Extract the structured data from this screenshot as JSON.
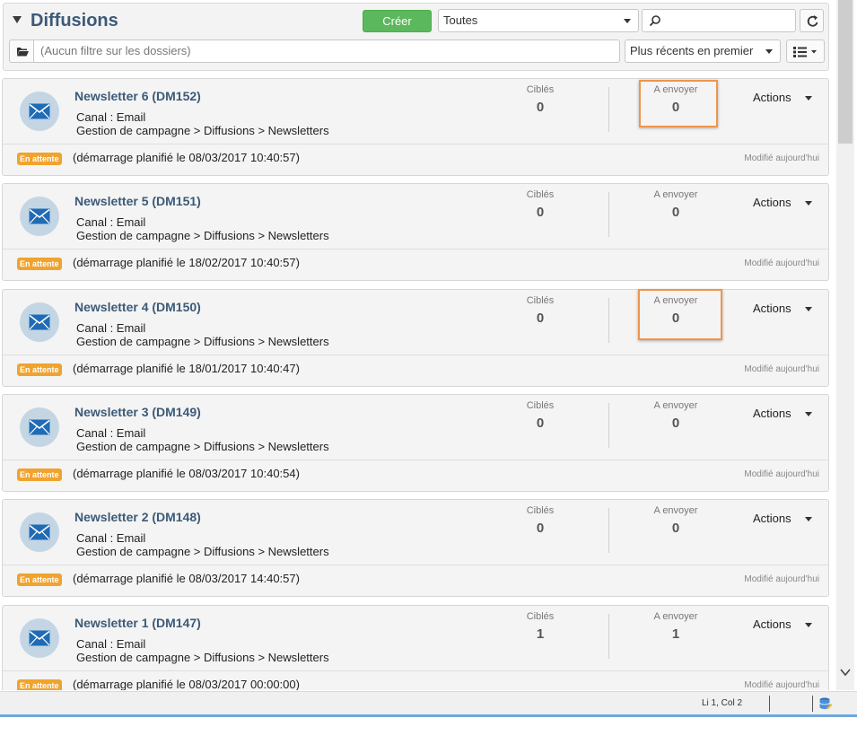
{
  "header": {
    "title": "Diffusions",
    "create_label": "Créer",
    "status_filter": "Toutes",
    "search_value": "",
    "folder_filter_placeholder": "(Aucun filtre sur les dossiers)",
    "sort_value": "Plus récents en premier"
  },
  "deliveries": [
    {
      "title": "Newsletter 6 (DM152)",
      "channel": "Canal : Email",
      "path": "Gestion de campagne > Diffusions > Newsletters",
      "targeted_label": "Ciblés",
      "targeted": "0",
      "tosend_label": "A envoyer",
      "tosend": "0",
      "actions": "Actions",
      "badge": "En attente",
      "schedule": "(démarrage planifié le 08/03/2017 10:40:57)",
      "modified": "Modifié aujourd'hui"
    },
    {
      "title": "Newsletter 5 (DM151)",
      "channel": "Canal : Email",
      "path": "Gestion de campagne > Diffusions > Newsletters",
      "targeted_label": "Ciblés",
      "targeted": "0",
      "tosend_label": "A envoyer",
      "tosend": "0",
      "actions": "Actions",
      "badge": "En attente",
      "schedule": "(démarrage planifié le 18/02/2017 10:40:57)",
      "modified": "Modifié aujourd'hui"
    },
    {
      "title": "Newsletter 4 (DM150)",
      "channel": "Canal : Email",
      "path": "Gestion de campagne > Diffusions > Newsletters",
      "targeted_label": "Ciblés",
      "targeted": "0",
      "tosend_label": "A envoyer",
      "tosend": "0",
      "actions": "Actions",
      "badge": "En attente",
      "schedule": "(démarrage planifié le 18/01/2017 10:40:47)",
      "modified": "Modifié aujourd'hui"
    },
    {
      "title": "Newsletter 3 (DM149)",
      "channel": "Canal : Email",
      "path": "Gestion de campagne > Diffusions > Newsletters",
      "targeted_label": "Ciblés",
      "targeted": "0",
      "tosend_label": "A envoyer",
      "tosend": "0",
      "actions": "Actions",
      "badge": "En attente",
      "schedule": "(démarrage planifié le 08/03/2017 10:40:54)",
      "modified": "Modifié aujourd'hui"
    },
    {
      "title": "Newsletter 2 (DM148)",
      "channel": "Canal : Email",
      "path": "Gestion de campagne > Diffusions > Newsletters",
      "targeted_label": "Ciblés",
      "targeted": "0",
      "tosend_label": "A envoyer",
      "tosend": "0",
      "actions": "Actions",
      "badge": "En attente",
      "schedule": "(démarrage planifié le 08/03/2017 14:40:57)",
      "modified": "Modifié aujourd'hui"
    },
    {
      "title": "Newsletter 1 (DM147)",
      "channel": "Canal : Email",
      "path": "Gestion de campagne > Diffusions > Newsletters",
      "targeted_label": "Ciblés",
      "targeted": "1",
      "tosend_label": "A envoyer",
      "tosend": "1",
      "actions": "Actions",
      "badge": "En attente",
      "schedule": "(démarrage planifié le 08/03/2017 00:00:00)",
      "modified": "Modifié aujourd'hui"
    }
  ],
  "statusbar": {
    "cursor": "Li 1, Col 2"
  },
  "colors": {
    "accent_green": "#5cb85c",
    "title_blue": "#3c5a78",
    "badge_orange": "#f0a32e",
    "highlight_orange": "#f0954a"
  }
}
